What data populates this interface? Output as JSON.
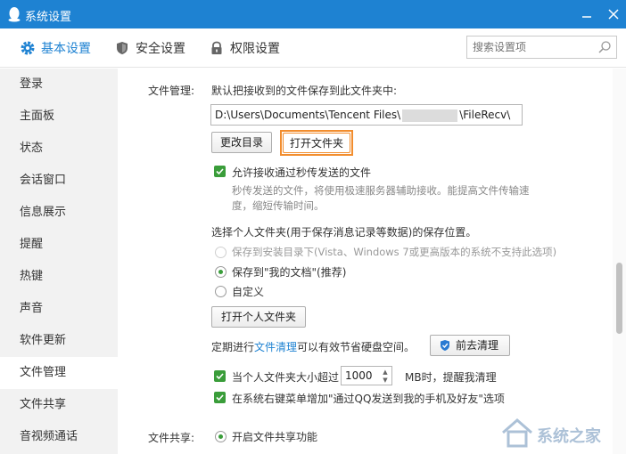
{
  "window": {
    "title": "系统设置",
    "icon": "qq-penguin-icon",
    "buttons": [
      "minimize-icon",
      "close-icon"
    ]
  },
  "tabs": [
    {
      "label": "基本设置",
      "icon": "gear-icon",
      "active": true
    },
    {
      "label": "安全设置",
      "icon": "shield-icon",
      "active": false
    },
    {
      "label": "权限设置",
      "icon": "lock-icon",
      "active": false
    }
  ],
  "search": {
    "placeholder": "搜索设置项",
    "icon": "search-icon"
  },
  "sidebar": {
    "items": [
      {
        "label": "登录"
      },
      {
        "label": "主面板"
      },
      {
        "label": "状态"
      },
      {
        "label": "会话窗口"
      },
      {
        "label": "信息展示"
      },
      {
        "label": "提醒"
      },
      {
        "label": "热键"
      },
      {
        "label": "声音"
      },
      {
        "label": "软件更新"
      },
      {
        "label": "文件管理",
        "active": true
      },
      {
        "label": "文件共享"
      },
      {
        "label": "音视频通话"
      }
    ]
  },
  "file_management": {
    "section_label": "文件管理:",
    "save_prompt": "默认把接收到的文件保存到此文件夹中:",
    "path_prefix": "D:\\Users\\Documents\\Tencent Files\\",
    "path_suffix": "\\FileRecv\\",
    "change_dir_button": "更改目录",
    "open_folder_button": "打开文件夹",
    "allow_flash_transfer": {
      "label": "允许接收通过秒传发送的文件",
      "checked": true
    },
    "flash_desc_line1": "秒传发送的文件，将使用极速服务器辅助接收。能提高文件传输速",
    "flash_desc_line2": "度，缩短传输时间。",
    "personal_folder_prompt": "选择个人文件夹(用于保存消息记录等数据)的保存位置。",
    "options": [
      {
        "label": "保存到安装目录下(Vista、Windows 7或更高版本的系统不支持此选项)",
        "selected": false,
        "disabled": true
      },
      {
        "label": "保存到\"我的文档\"(推荐)",
        "selected": true,
        "disabled": false
      },
      {
        "label": "自定义",
        "selected": false,
        "disabled": false
      }
    ],
    "open_personal_button": "打开个人文件夹",
    "cleanup_prefix": "定期进行",
    "cleanup_link": "文件清理",
    "cleanup_suffix": "可以有效节省硬盘空间。",
    "cleanup_button": "前去清理",
    "cleanup_button_icon": "shield-check-icon",
    "size_reminder": {
      "prefix": "当个人文件夹大小超过",
      "value": "1000",
      "suffix": "MB时，提醒我清理",
      "checked": true
    },
    "context_menu": {
      "label": "在系统右键菜单增加\"通过QQ发送到我的手机及好友\"选项",
      "checked": true
    }
  },
  "file_sharing": {
    "section_label": "文件共享:",
    "enable": {
      "label": "开启文件共享功能",
      "selected": true
    }
  },
  "watermark": {
    "text": "系统之家"
  }
}
